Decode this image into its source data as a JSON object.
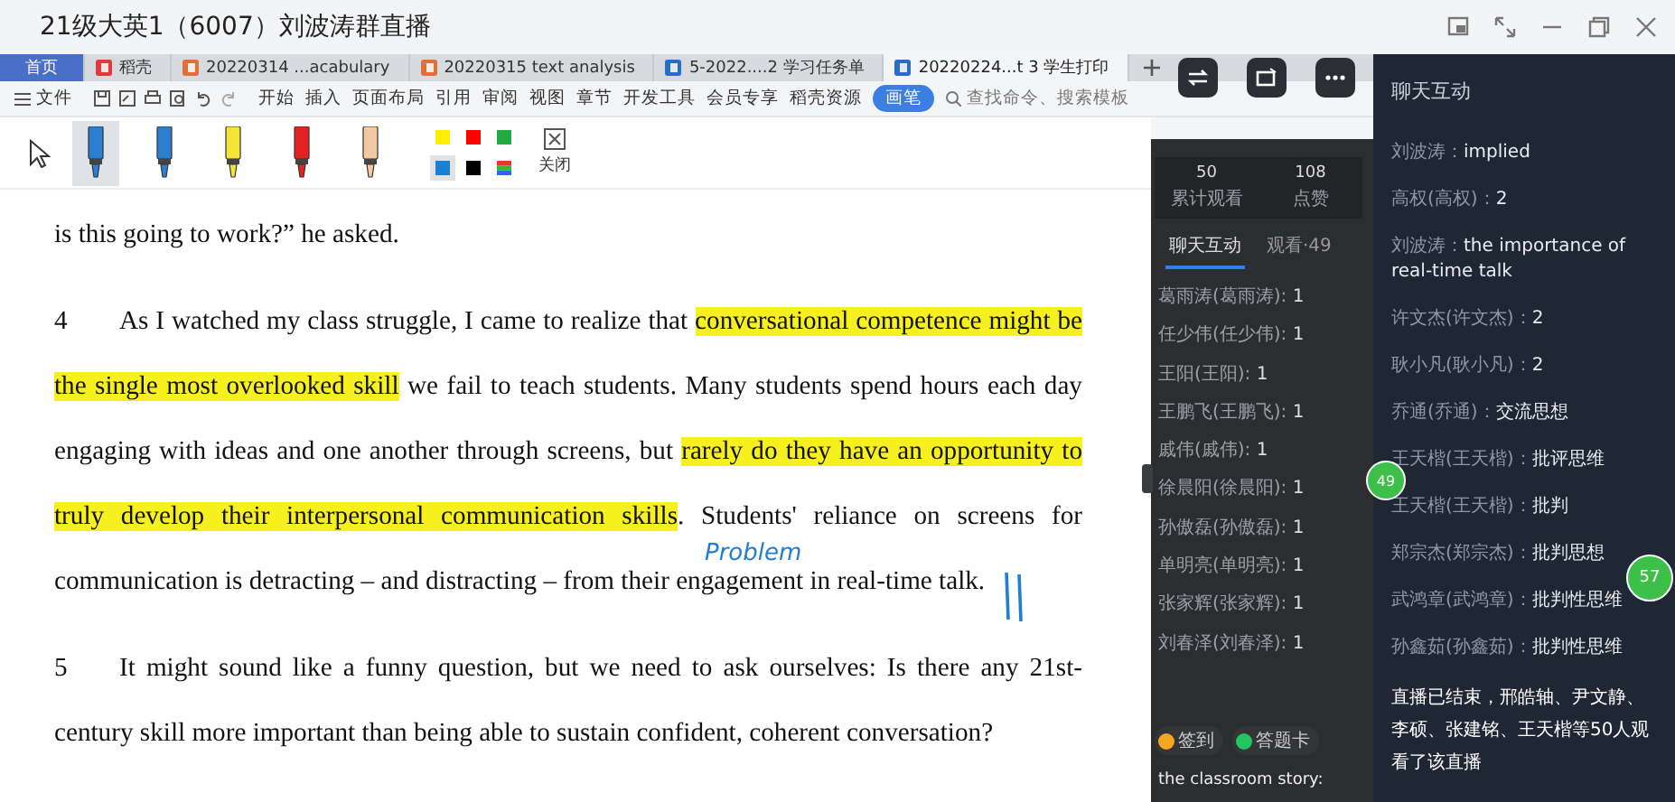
{
  "window": {
    "title": "21级大英1（6007）刘波涛群直播"
  },
  "wps_tabs": [
    {
      "label": "首页",
      "kind": "home",
      "selected": false
    },
    {
      "label": "稻壳",
      "kind": "docer",
      "selected": false
    },
    {
      "label": "20220314 ...acabulary",
      "kind": "ppt",
      "selected": false
    },
    {
      "label": "20220315 text analysis",
      "kind": "ppt",
      "selected": false
    },
    {
      "label": "5-2022....2 学习任务单",
      "kind": "word",
      "selected": false
    },
    {
      "label": "20220224...t 3 学生打印",
      "kind": "word",
      "selected": true
    }
  ],
  "toolbar": {
    "file": "文件",
    "menus": [
      "开始",
      "插入",
      "页面布局",
      "引用",
      "审阅",
      "视图",
      "章节",
      "开发工具",
      "会员专享",
      "稻壳资源"
    ],
    "pen_button": "画笔",
    "search": {
      "placeholder": "查找命令、搜索模板"
    }
  },
  "pen_bar": {
    "pens": [
      {
        "color": "#2a7fd0",
        "selected": true
      },
      {
        "color": "#2a7fd0",
        "selected": false
      },
      {
        "color": "#f3e437",
        "selected": false
      },
      {
        "color": "#e52222",
        "selected": false
      },
      {
        "color": "#f2c9a0",
        "selected": false
      }
    ],
    "swatches": [
      {
        "color": "#ffee00",
        "selected": false
      },
      {
        "color": "#ff0000",
        "selected": false
      },
      {
        "color": "#22aa44",
        "selected": false
      },
      {
        "color": "#1e7fd0",
        "selected": true
      },
      {
        "color": "#000000",
        "selected": false
      }
    ],
    "close": "关闭"
  },
  "document": {
    "paragraphs": [
      {
        "segments": [
          {
            "text": "is this going to work?” he asked.",
            "highlight": false
          }
        ]
      },
      {
        "number": "4",
        "segments": [
          {
            "text": "As I watched my class struggle, I came to realize that ",
            "highlight": false
          },
          {
            "text": "conversational competence might be the single most overlooked skill",
            "highlight": true
          },
          {
            "text": " we fail to teach students. Many students spend hours each day engaging with ideas and one another through screens, but ",
            "highlight": false
          },
          {
            "text": "rarely do they have an opportunity to truly develop their interpersonal communication skills",
            "highlight": true
          },
          {
            "text": ". Students' reliance on screens for communication is detracting – and distracting – from their engagement in real-time talk.",
            "highlight": false
          }
        ]
      },
      {
        "number": "5",
        "segments": [
          {
            "text": "It might sound like a funny question, but we need to ask ourselves: Is there any 21st-century skill more important than being able to sustain confident, coherent conversation?",
            "highlight": false
          }
        ]
      }
    ],
    "ink_note": "Problem"
  },
  "live_panel": {
    "stats": [
      {
        "value": "50",
        "label": "累计观看"
      },
      {
        "value": "108",
        "label": "点赞"
      }
    ],
    "tabs": [
      {
        "label": "聊天互动",
        "selected": true
      },
      {
        "label": "观看·49",
        "selected": false
      }
    ],
    "entries": [
      {
        "name": "葛雨涛(葛雨涛):",
        "text": "1"
      },
      {
        "name": "任少伟(任少伟):",
        "text": "1"
      },
      {
        "name": "王阳(王阳):",
        "text": "1"
      },
      {
        "name": "王鹏飞(王鹏飞):",
        "text": "1"
      },
      {
        "name": "戚伟(戚伟):",
        "text": "1"
      },
      {
        "name": "徐晨阳(徐晨阳):",
        "text": "1"
      },
      {
        "name": "孙傲磊(孙傲磊):",
        "text": "1"
      },
      {
        "name": "单明亮(单明亮):",
        "text": "1"
      },
      {
        "name": "张家辉(张家辉):",
        "text": "1"
      },
      {
        "name": "刘春泽(刘春泽):",
        "text": "1"
      }
    ],
    "actions": [
      {
        "label": "签到",
        "color": "#f5a623"
      },
      {
        "label": "答题卡",
        "color": "#22c55e"
      }
    ],
    "input": {
      "value": "the classroom story:"
    },
    "badge": "49"
  },
  "chat": {
    "title": "聊天互动",
    "messages": [
      {
        "name": "刘波涛：",
        "text": "implied"
      },
      {
        "name": "高权(高权)：",
        "text": "2"
      },
      {
        "name": "刘波涛：",
        "text": "the importance of real-time talk"
      },
      {
        "name": "许文杰(许文杰)：",
        "text": "2"
      },
      {
        "name": "耿小凡(耿小凡)：",
        "text": "2"
      },
      {
        "name": "乔通(乔通)：",
        "text": "交流思想"
      },
      {
        "name": "王天楷(王天楷)：",
        "text": "批评思维"
      },
      {
        "name": "王天楷(王天楷)：",
        "text": "批判"
      },
      {
        "name": "郑宗杰(郑宗杰)：",
        "text": "批判思想"
      },
      {
        "name": "武鸿章(武鸿章)：",
        "text": "批判性思维"
      },
      {
        "name": "孙鑫茹(孙鑫茹)：",
        "text": "批判性思维"
      }
    ],
    "notice": "直播已结束，邢皓轴、尹文静、李硕、张建铭、王天楷等50人观看了该直播",
    "badge": "57"
  }
}
